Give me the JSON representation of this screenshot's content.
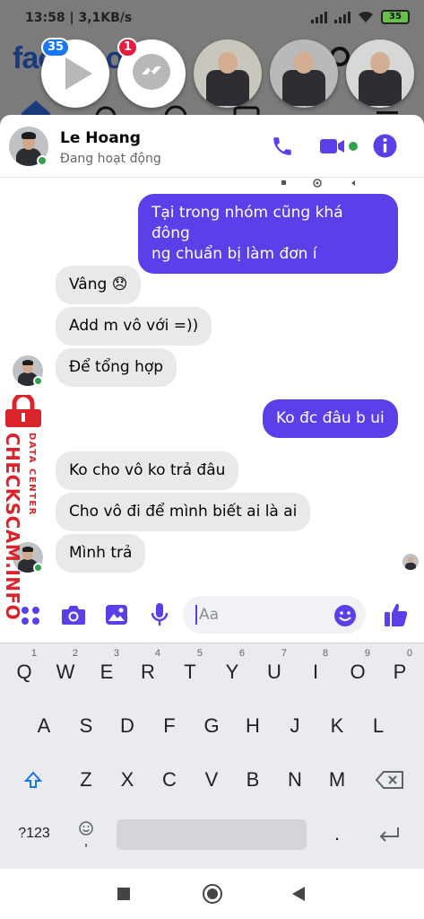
{
  "status_bar": {
    "time": "13:58",
    "speed": "3,1KB/s",
    "battery": "35"
  },
  "facebook_bg": {
    "logo": "facebook"
  },
  "chat_heads": [
    {
      "kind": "video",
      "badge": "35"
    },
    {
      "kind": "messenger",
      "badge": "1"
    },
    {
      "kind": "photo"
    },
    {
      "kind": "photo"
    },
    {
      "kind": "photo"
    }
  ],
  "chat": {
    "contact_name": "Le Hoang",
    "contact_status": "Đang hoạt động",
    "messages": [
      {
        "dir": "out",
        "lines": [
          "Tại trong nhóm cũng khá đông",
          "ng chuẩn bị làm đơn í"
        ]
      },
      {
        "dir": "in",
        "text": "Vâng 😞"
      },
      {
        "dir": "in",
        "text": "Add m vô với =))"
      },
      {
        "dir": "in",
        "text": "Để tổng hợp"
      },
      {
        "dir": "out",
        "text": "Ko đc đâu b ui"
      },
      {
        "dir": "in",
        "text": "Ko cho vô ko trả đâu"
      },
      {
        "dir": "in",
        "text": "Cho vô đi để mình biết ai là ai"
      },
      {
        "dir": "in",
        "text": "Mình trả"
      }
    ],
    "composer_placeholder": "Aa"
  },
  "watermark": {
    "line1": "CHECKSCAM.INFO",
    "line2": "DATA CENTER"
  },
  "keyboard": {
    "row1": [
      "Q",
      "W",
      "E",
      "R",
      "T",
      "Y",
      "U",
      "I",
      "O",
      "P"
    ],
    "row1_hints": [
      "1",
      "2",
      "3",
      "4",
      "5",
      "6",
      "7",
      "8",
      "9",
      "0"
    ],
    "row2": [
      "A",
      "S",
      "D",
      "F",
      "G",
      "H",
      "J",
      "K",
      "L"
    ],
    "row3": [
      "Z",
      "X",
      "C",
      "V",
      "B",
      "N",
      "M"
    ],
    "symbols_key": "?123",
    "comma": ",",
    "period": "."
  },
  "colors": {
    "accent": "#5b3fe8",
    "messenger_blue": "#4b3fe0",
    "online": "#31a24c",
    "watermark": "#d9242b"
  }
}
